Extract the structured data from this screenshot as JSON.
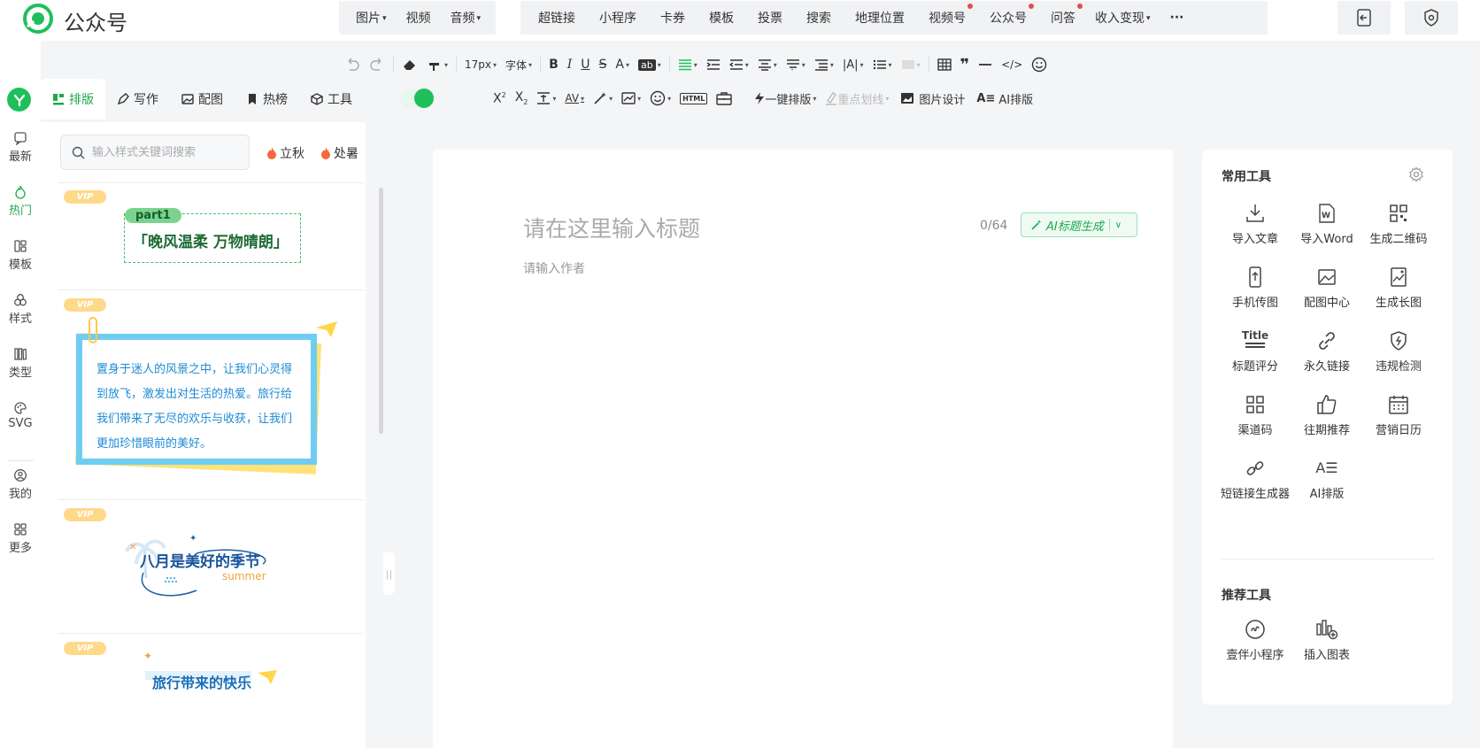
{
  "app": {
    "name": "公众号"
  },
  "top_menu": {
    "media": [
      {
        "label": "图片",
        "caret": "▾"
      },
      {
        "label": "视频"
      },
      {
        "label": "音频",
        "caret": "▾"
      }
    ],
    "inserts": [
      {
        "label": "超链接"
      },
      {
        "label": "小程序"
      },
      {
        "label": "卡券"
      },
      {
        "label": "模板"
      },
      {
        "label": "投票"
      },
      {
        "label": "搜索"
      },
      {
        "label": "地理位置"
      },
      {
        "label": "视频号",
        "dot": true
      },
      {
        "label": "公众号",
        "dot": true
      },
      {
        "label": "问答",
        "dot": true
      },
      {
        "label": "收入变现",
        "caret": "▾"
      },
      {
        "label": "···"
      }
    ]
  },
  "left_nav": [
    {
      "label": "最新",
      "icon": "message-icon"
    },
    {
      "label": "热门",
      "icon": "flame-icon",
      "active": true
    },
    {
      "label": "模板",
      "icon": "template-icon"
    },
    {
      "label": "样式",
      "icon": "style-icon"
    },
    {
      "label": "类型",
      "icon": "books-icon"
    },
    {
      "label": "SVG",
      "icon": "palette-icon"
    },
    {
      "label": "我的",
      "icon": "user-icon"
    },
    {
      "label": "更多",
      "icon": "grid-icon"
    }
  ],
  "tabs": [
    {
      "label": "排版",
      "icon": "layout-icon",
      "active": true
    },
    {
      "label": "写作",
      "icon": "pen-icon"
    },
    {
      "label": "配图",
      "icon": "image-icon"
    },
    {
      "label": "热榜",
      "icon": "bookmark-icon"
    },
    {
      "label": "工具",
      "icon": "cube-icon"
    }
  ],
  "search": {
    "placeholder": "输入样式关键词搜索"
  },
  "hot_tags": [
    "立秋",
    "处暑"
  ],
  "templates": {
    "vip_label": "VIP",
    "t1": {
      "badge": "part1",
      "text": "「晚风温柔 万物晴朗」"
    },
    "t2": {
      "text": "置身于迷人的风景之中，让我们心灵得到放飞，激发出对生活的热爱。旅行给我们带来了无尽的欢乐与收获，让我们更加珍惜眼前的美好。"
    },
    "t3": {
      "text": "八月是美好的季节",
      "sub": "summer"
    },
    "t4": {
      "text": "旅行带来的快乐"
    }
  },
  "toolbar": {
    "font_size": "17px",
    "font_family": "字体",
    "one_key_layout": "一键排版",
    "highlight_line": "重点划线",
    "image_design": "图片设计",
    "ai_layout": "AI排版",
    "html_tag": "HTML"
  },
  "editor": {
    "title_placeholder": "请在这里输入标题",
    "author_placeholder": "请输入作者",
    "title_count": "0/64",
    "ai_title_button": "AI标题生成"
  },
  "right_panel": {
    "common_title": "常用工具",
    "common_tools": [
      {
        "label": "导入文章",
        "icon": "import-article-icon"
      },
      {
        "label": "导入Word",
        "icon": "word-icon"
      },
      {
        "label": "生成二维码",
        "icon": "qrcode-icon"
      },
      {
        "label": "手机传图",
        "icon": "phone-upload-icon"
      },
      {
        "label": "配图中心",
        "icon": "picture-icon"
      },
      {
        "label": "生成长图",
        "icon": "long-image-icon"
      },
      {
        "label": "标题评分",
        "icon": "title-score-icon"
      },
      {
        "label": "永久链接",
        "icon": "link-icon"
      },
      {
        "label": "违规检测",
        "icon": "shield-check-icon"
      },
      {
        "label": "渠道码",
        "icon": "channel-code-icon"
      },
      {
        "label": "往期推荐",
        "icon": "thumb-up-icon"
      },
      {
        "label": "营销日历",
        "icon": "calendar-icon"
      },
      {
        "label": "短链接生成器",
        "icon": "short-link-icon"
      },
      {
        "label": "AI排版",
        "icon": "ai-layout-icon"
      }
    ],
    "recommend_title": "推荐工具",
    "recommend_tools": [
      {
        "label": "壹伴小程序",
        "icon": "mini-program-icon"
      },
      {
        "label": "插入图表",
        "icon": "chart-insert-icon"
      }
    ],
    "title_icon_text": "Title"
  },
  "colors": {
    "accent": "#1fbf5b",
    "accent_text": "#1fa94d",
    "vip": "#ffd98a",
    "badge_dot": "#e84a4a"
  }
}
